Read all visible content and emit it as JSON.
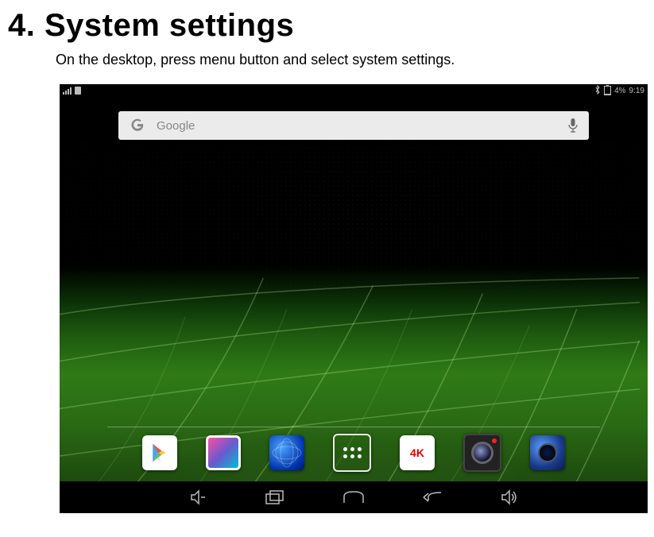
{
  "heading": "4. System settings",
  "instruction": "On the desktop, press menu button and select system settings.",
  "statusbar": {
    "battery_percent": "4%",
    "time": "9:19"
  },
  "search": {
    "placeholder": "Google"
  },
  "dock": {
    "apps": [
      {
        "name": "play-store"
      },
      {
        "name": "gallery"
      },
      {
        "name": "browser"
      },
      {
        "name": "app-drawer"
      },
      {
        "name": "4k-player",
        "label": "4K"
      },
      {
        "name": "camera"
      },
      {
        "name": "sound"
      }
    ]
  }
}
